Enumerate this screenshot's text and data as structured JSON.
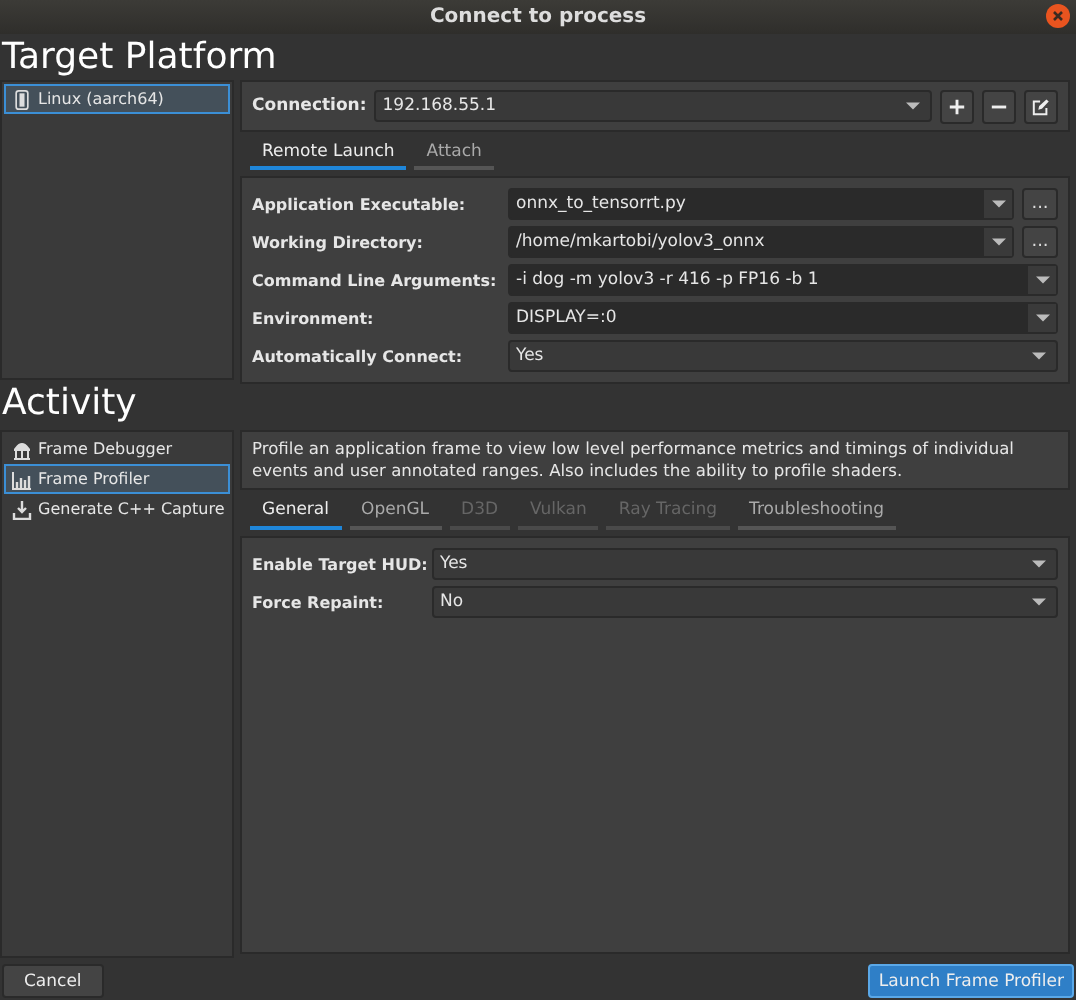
{
  "window": {
    "title": "Connect to process"
  },
  "target_platform": {
    "heading": "Target Platform",
    "platforms": [
      {
        "label": "Linux (aarch64)",
        "selected": true
      }
    ],
    "connection": {
      "label": "Connection:",
      "value": "192.168.55.1"
    },
    "tabs": [
      {
        "label": "Remote Launch",
        "selected": true
      },
      {
        "label": "Attach",
        "selected": false
      }
    ],
    "fields": [
      {
        "kind": "browse",
        "label": "Application Executable:",
        "value": "onnx_to_tensorrt.py",
        "button": "..."
      },
      {
        "kind": "browse",
        "label": "Working Directory:",
        "value": "/home/mkartobi/yolov3_onnx",
        "button": "..."
      },
      {
        "kind": "editable",
        "label": "Command Line Arguments:",
        "value": "-i dog -m yolov3 -r 416 -p FP16 -b 1"
      },
      {
        "kind": "editable",
        "label": "Environment:",
        "value": "DISPLAY=:0"
      },
      {
        "kind": "select",
        "label": "Automatically Connect:",
        "value": "Yes"
      }
    ]
  },
  "activity": {
    "heading": "Activity",
    "items": [
      {
        "label": "Frame Debugger",
        "kind": "debugger",
        "selected": false
      },
      {
        "label": "Frame Profiler",
        "kind": "profiler",
        "selected": true
      },
      {
        "label": "Generate C++ Capture",
        "kind": "capture",
        "selected": false
      }
    ],
    "description": "Profile an application frame to view low level performance metrics and timings of individual events and user annotated ranges. Also includes the ability to profile shaders.",
    "tabs": [
      {
        "label": "General",
        "selected": true,
        "disabled": false
      },
      {
        "label": "OpenGL",
        "selected": false,
        "disabled": false
      },
      {
        "label": "D3D",
        "selected": false,
        "disabled": true
      },
      {
        "label": "Vulkan",
        "selected": false,
        "disabled": true
      },
      {
        "label": "Ray Tracing",
        "selected": false,
        "disabled": true
      },
      {
        "label": "Troubleshooting",
        "selected": false,
        "disabled": false
      }
    ],
    "fields": [
      {
        "kind": "select",
        "label": "Enable Target HUD:",
        "value": "Yes"
      },
      {
        "kind": "select",
        "label": "Force Repaint:",
        "value": "No"
      }
    ]
  },
  "buttons": [
    {
      "label": "Cancel",
      "primary": false
    },
    {
      "label": "Launch Frame Profiler",
      "primary": true
    }
  ]
}
